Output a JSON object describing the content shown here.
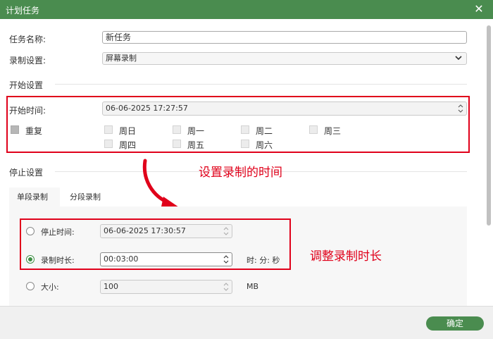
{
  "window": {
    "title": "计划任务"
  },
  "task": {
    "name_label": "任务名称:",
    "name_value": "新任务"
  },
  "record": {
    "label": "录制设置:",
    "value": "屏幕录制"
  },
  "start": {
    "section": "开始设置",
    "time_label": "开始时间:",
    "time_value": "06-06-2025 17:27:57",
    "repeat_label": "重复",
    "days": [
      "周日",
      "周一",
      "周二",
      "周三",
      "周四",
      "周五",
      "周六"
    ]
  },
  "stop": {
    "section": "停止设置",
    "tabs": [
      "单段录制",
      "分段录制"
    ],
    "stop_time_label": "停止时间:",
    "stop_time_value": "06-06-2025 17:30:57",
    "duration_label": "录制时长:",
    "duration_value": "00:03:00",
    "duration_unit": "时: 分: 秒",
    "size_label": "大小:",
    "size_value": "100",
    "size_unit": "MB"
  },
  "annotations": {
    "start_note": "设置录制的时间",
    "duration_note": "调整录制时长"
  },
  "footer": {
    "ok_label": "确定"
  },
  "colors": {
    "accent": "#4a8c4f",
    "highlight": "#e0001a"
  }
}
